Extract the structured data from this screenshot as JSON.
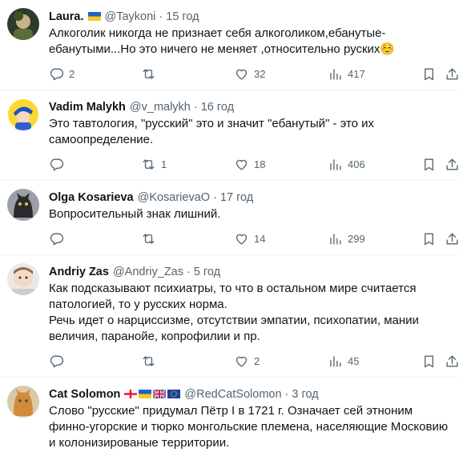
{
  "tweets": [
    {
      "name": "Laura.",
      "flags": [
        "ua"
      ],
      "handle": "@Taykoni",
      "dot": "·",
      "time": "15 год",
      "text": [
        "Алкоголик никогда не признает себя алкоголиком,ебанутые-ебанутыми...Но это ничего не меняет ,относительно руских☺️"
      ],
      "replies": "2",
      "retweets": "",
      "likes": "32",
      "views": "417"
    },
    {
      "name": "Vadim Malykh",
      "flags": [],
      "handle": "@v_malykh",
      "dot": "·",
      "time": "16 год",
      "text": [
        "Это тавтология, \"русский\" это и значит \"ебанутый\" - это их самоопределение."
      ],
      "replies": "",
      "retweets": "1",
      "likes": "18",
      "views": "406"
    },
    {
      "name": "Olga Kosarieva",
      "flags": [],
      "handle": "@KosarievaO",
      "dot": "·",
      "time": "17 год",
      "text": [
        "Вопросительный знак лишний."
      ],
      "replies": "",
      "retweets": "",
      "likes": "14",
      "views": "299"
    },
    {
      "name": "Andriy Zas",
      "flags": [],
      "handle": "@Andriy_Zas",
      "dot": "·",
      "time": "5 год",
      "text": [
        "Как подсказывают  психиатры, то что в остальном мире считается патологией, то у русских норма.",
        "Речь идет о нарциссизме, отсутствии эмпатии, психопатии, мании величия, паранойе, копрофилии и пр."
      ],
      "replies": "",
      "retweets": "",
      "likes": "2",
      "views": "45"
    },
    {
      "name": "Cat Solomon",
      "flags": [
        "ge",
        "ua",
        "gb",
        "eu"
      ],
      "handle": "@RedCatSolomon",
      "dot": "·",
      "time": "3 год",
      "text": [
        "Слово \"русские\" придумал Пётр I в 1721 г. Означает сей этноним финно-угорские и тюрко монгольские племена, населяющие Московию и колонизированые территории."
      ],
      "replies": "",
      "retweets": "",
      "likes": "",
      "views": ""
    }
  ],
  "icons": {
    "reply": "reply-icon",
    "retweet": "retweet-icon",
    "like": "like-icon",
    "views": "views-icon",
    "bookmark": "bookmark-icon",
    "share": "share-icon"
  },
  "colors": {
    "text": "#0f1419",
    "secondary": "#536471",
    "divider": "#eff3f4"
  }
}
